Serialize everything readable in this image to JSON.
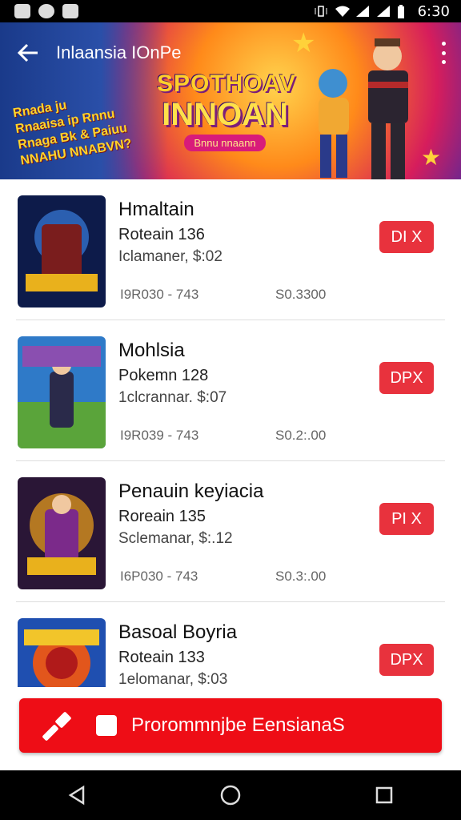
{
  "status_bar": {
    "time": "6:30",
    "icons": [
      "gallery-icon",
      "notification-icon",
      "clipboard-icon",
      "vibrate-icon",
      "wifi-icon",
      "signal-icon",
      "signal-icon",
      "battery-icon"
    ]
  },
  "app_bar": {
    "title": "Inlaansia IOnPe",
    "back_icon": "arrow-back-icon",
    "menu_icon": "more-vert-icon"
  },
  "banner": {
    "promo_lines": [
      "Rnada ju",
      "Rnaaisa ip Rnnu",
      "Rnaga Bk & Paiuu",
      "NNAHU NNABVN?"
    ],
    "logo_top": "SPOTHOAV",
    "logo_main": "INNOAN",
    "logo_badge": "Bnnu nnaann"
  },
  "items": [
    {
      "name": "Hmaltain",
      "line1": "Roteain 136",
      "line2": "Iclamaner, $:02",
      "code": "I9R030 - 743",
      "price": "S0.3300",
      "button": "DI X",
      "thumb_colors": [
        "#0d1b4a",
        "#2b5fb0",
        "#e9b11c"
      ]
    },
    {
      "name": "Mohlsia",
      "line1": "Pokemn 128",
      "line2": "1clcrannar. $:07",
      "code": "I9R039 - 743",
      "price": "S0.2:.00",
      "button": "DPX",
      "thumb_colors": [
        "#2f7ac8",
        "#5aa43a",
        "#8a4fb0"
      ]
    },
    {
      "name": "Penauin keyiacia",
      "line1": "Roreain 135",
      "line2": "Sclemanar, $:.12",
      "code": "I6P030 - 743",
      "price": "S0.3:.00",
      "button": "PI X",
      "thumb_colors": [
        "#2a1636",
        "#7b2a8a",
        "#f0a21a"
      ]
    },
    {
      "name": "Basoal Boyria",
      "line1": "Roteain 133",
      "line2": "1elomanar, $:03",
      "code": "",
      "price": "",
      "button": "DPX",
      "thumb_colors": [
        "#1f4fb0",
        "#e2561c",
        "#f2c52a"
      ]
    }
  ],
  "cta": {
    "label": "Prorommnjbe EensianaS",
    "icon": "hammer-icon"
  },
  "nav": {
    "back": "nav-back-icon",
    "home": "nav-home-icon",
    "recents": "nav-recents-icon"
  }
}
